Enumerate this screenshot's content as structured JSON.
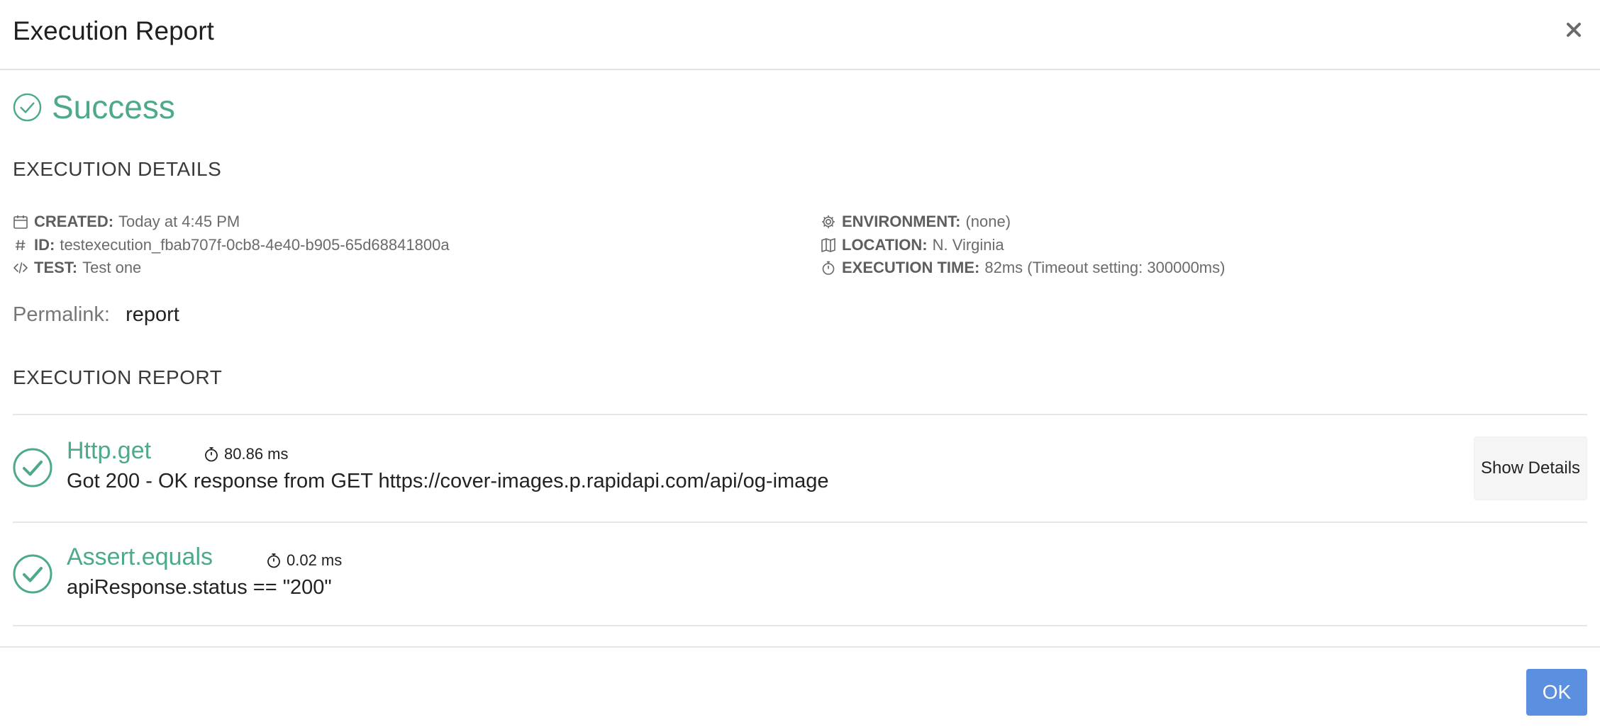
{
  "header": {
    "title": "Execution Report",
    "close_icon": "close-icon"
  },
  "status": {
    "text": "Success",
    "icon": "check-circle-icon",
    "color": "#4caa8a"
  },
  "execution_details": {
    "heading": "EXECUTION DETAILS",
    "created": {
      "label": "CREATED:",
      "value": "Today at 4:45 PM",
      "icon": "calendar-icon"
    },
    "id": {
      "label": "ID:",
      "value": "testexecution_fbab707f-0cb8-4e40-b905-65d68841800a",
      "icon": "hash-icon"
    },
    "test": {
      "label": "TEST:",
      "value": "Test one",
      "icon": "code-icon"
    },
    "environment": {
      "label": "ENVIRONMENT:",
      "value": "(none)",
      "icon": "gear-icon"
    },
    "location": {
      "label": "LOCATION:",
      "value": "N. Virginia",
      "icon": "map-icon"
    },
    "execution_time": {
      "label": "EXECUTION TIME:",
      "value": "82ms (Timeout setting: 300000ms)",
      "icon": "stopwatch-icon"
    }
  },
  "permalink": {
    "label": "Permalink:",
    "value": "report"
  },
  "execution_report": {
    "heading": "EXECUTION REPORT",
    "items": [
      {
        "title": "Http.get",
        "timing": "80.86 ms",
        "description": "Got 200 - OK response from GET https://cover-images.p.rapidapi.com/api/og-image",
        "status": "success",
        "show_details_label": "Show Details"
      },
      {
        "title": "Assert.equals",
        "timing": "0.02 ms",
        "description": "apiResponse.status == \"200\"",
        "status": "success"
      }
    ]
  },
  "footer": {
    "ok_label": "OK"
  },
  "colors": {
    "accent_green": "#4caa8a",
    "primary_blue": "#5b8fe0"
  }
}
